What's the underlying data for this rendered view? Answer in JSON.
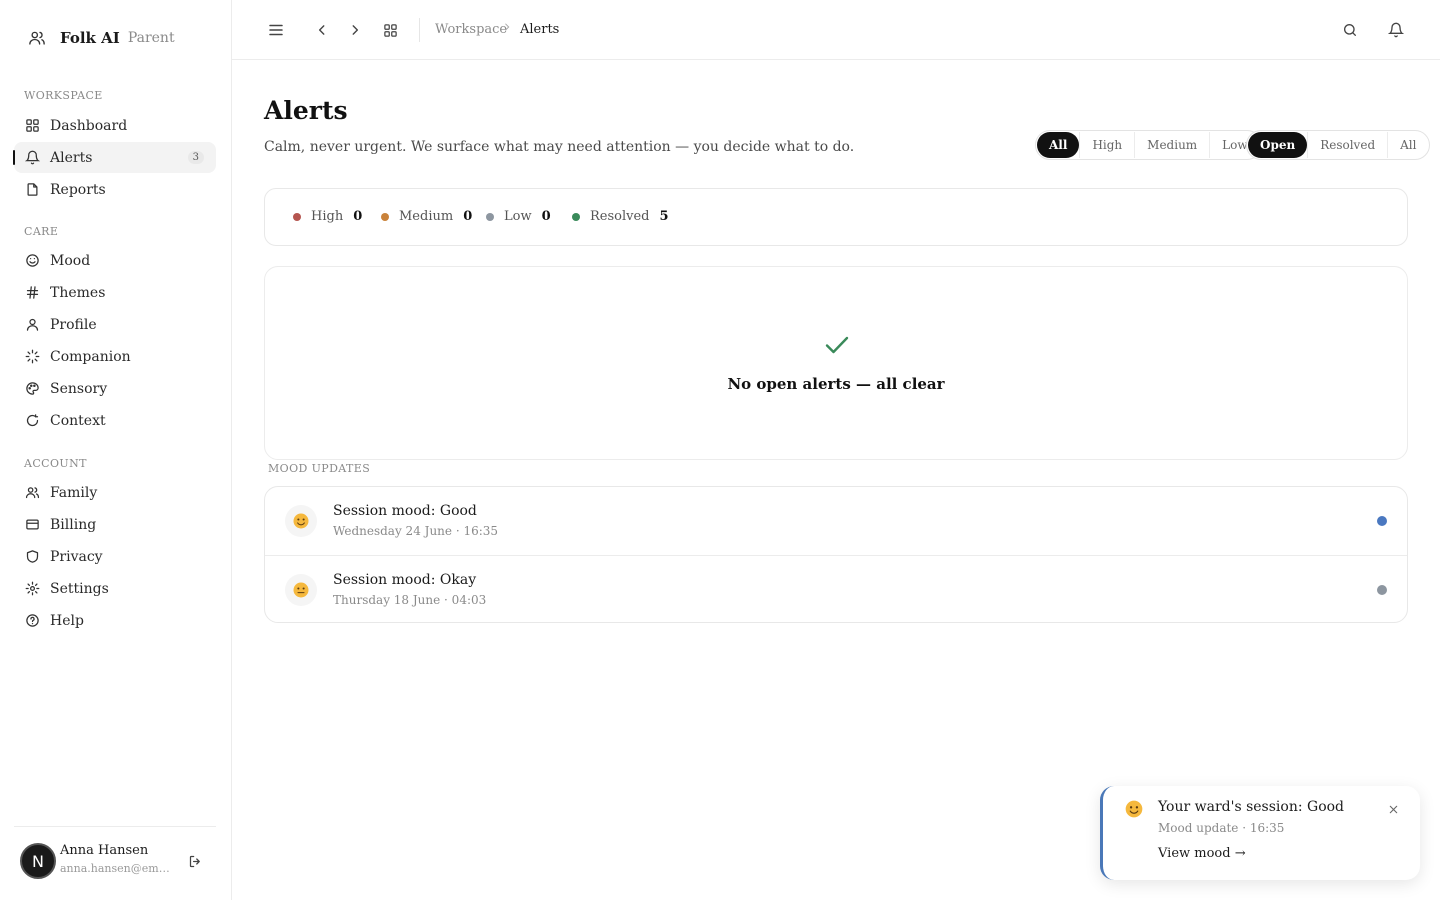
{
  "brand": {
    "name": "Folk AI",
    "role": "Parent"
  },
  "sidebar": {
    "sections": {
      "workspace": "WORKSPACE",
      "care": "CARE",
      "account": "ACCOUNT"
    },
    "workspace_items": [
      {
        "label": "Dashboard",
        "icon": "grid-icon"
      },
      {
        "label": "Alerts",
        "icon": "bell-icon",
        "count": "3",
        "active": true
      },
      {
        "label": "Reports",
        "icon": "file-icon"
      }
    ],
    "care_items": [
      {
        "label": "Mood",
        "icon": "smile-icon"
      },
      {
        "label": "Themes",
        "icon": "hash-icon"
      },
      {
        "label": "Profile",
        "icon": "user-icon"
      },
      {
        "label": "Companion",
        "icon": "sparkle-icon"
      },
      {
        "label": "Sensory",
        "icon": "palette-icon"
      },
      {
        "label": "Context",
        "icon": "circle-icon"
      }
    ],
    "account_items": [
      {
        "label": "Family",
        "icon": "users-icon"
      },
      {
        "label": "Billing",
        "icon": "card-icon"
      },
      {
        "label": "Privacy",
        "icon": "shield-icon"
      },
      {
        "label": "Settings",
        "icon": "gear-icon"
      },
      {
        "label": "Help",
        "icon": "help-icon"
      }
    ]
  },
  "user": {
    "initial": "N",
    "name": "Anna Hansen",
    "email": "anna.hansen@email.com"
  },
  "topbar": {
    "breadcrumb": [
      "Workspace",
      "Alerts"
    ]
  },
  "page": {
    "title": "Alerts",
    "subtitle": "Calm, never urgent. We surface what may need attention — you decide what to do."
  },
  "filters": {
    "severity": [
      "All",
      "High",
      "Medium",
      "Low"
    ],
    "severity_selected": "All",
    "status": [
      "Open",
      "Resolved",
      "All"
    ],
    "status_selected": "Open"
  },
  "stats": [
    {
      "name": "High",
      "value": "0",
      "color": "#b5554f"
    },
    {
      "name": "Medium",
      "value": "0",
      "color": "#c9823a"
    },
    {
      "name": "Low",
      "value": "0",
      "color": "#8d96a0"
    },
    {
      "name": "Resolved",
      "value": "5",
      "color": "#3a8a5a"
    }
  ],
  "empty_state": {
    "text": "No open alerts — all clear",
    "icon": "check-icon",
    "color": "#3a8a5a"
  },
  "mood_updates": {
    "label": "MOOD UPDATES",
    "items": [
      {
        "title": "Session mood: Good",
        "time": "Wednesday 24 June · 16:35",
        "dot_color": "#4a78c0",
        "emoji": "slightly-smiling-face"
      },
      {
        "title": "Session mood: Okay",
        "time": "Thursday 18 June · 04:03",
        "dot_color": "#8d96a0",
        "emoji": "neutral-face"
      }
    ]
  },
  "toast": {
    "title": "Your ward's session: Good",
    "subtitle": "Mood update · 16:35",
    "link": "View mood →",
    "emoji": "slightly-smiling-face",
    "accent": "#4a78b8"
  }
}
